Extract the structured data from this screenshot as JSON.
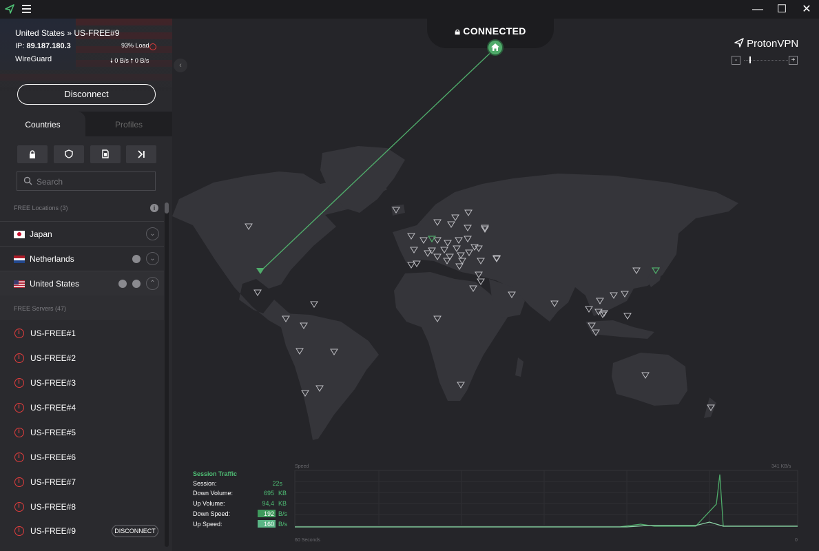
{
  "window": {
    "minimize_glyph": "—",
    "maximize_glyph": "☐",
    "close_glyph": "✕",
    "app_icon": "protonvpn-logo-icon",
    "menu_icon": "hamburger-menu-icon"
  },
  "connection": {
    "server": "United States » US-FREE#9",
    "ip_label": "IP:",
    "ip": "89.187.180.3",
    "load": "93% Load",
    "protocol": "WireGuard",
    "down_speed": "0 B/s",
    "up_speed": "0 B/s",
    "disconnect_label": "Disconnect"
  },
  "tabs": {
    "countries": "Countries",
    "profiles": "Profiles"
  },
  "filters": {
    "icons": [
      "lock-icon",
      "shield-icon",
      "file-icon",
      "arrow-skip-icon"
    ]
  },
  "search": {
    "placeholder": "Search"
  },
  "free_locations": {
    "header": "FREE Locations (3)",
    "countries": [
      {
        "name": "Japan"
      },
      {
        "name": "Netherlands"
      },
      {
        "name": "United States"
      }
    ]
  },
  "free_servers": {
    "header": "FREE Servers (47)",
    "servers": [
      {
        "name": "US-FREE#1"
      },
      {
        "name": "US-FREE#2"
      },
      {
        "name": "US-FREE#3"
      },
      {
        "name": "US-FREE#4"
      },
      {
        "name": "US-FREE#5"
      },
      {
        "name": "US-FREE#6"
      },
      {
        "name": "US-FREE#7"
      },
      {
        "name": "US-FREE#8"
      },
      {
        "name": "US-FREE#9"
      }
    ],
    "active_disconnect_label": "DISCONNECT"
  },
  "status": {
    "text": "CONNECTED",
    "color": "#4fab6a"
  },
  "brand": {
    "name": "ProtonVPN",
    "zoom_minus": "-",
    "zoom_plus": "+"
  },
  "session": {
    "title": "Session Traffic",
    "session_label": "Session:",
    "session_value": "22s",
    "down_volume_label": "Down Volume:",
    "down_volume_value": "695",
    "down_volume_unit": "KB",
    "up_volume_label": "Up Volume:",
    "up_volume_value": "94,4",
    "up_volume_unit": "KB",
    "down_speed_label": "Down Speed:",
    "down_speed_value": "192",
    "down_speed_unit": "B/s",
    "up_speed_label": "Up Speed:",
    "up_speed_value": "160",
    "up_speed_unit": "B/s"
  },
  "graph": {
    "speed_label": "Speed",
    "max_label": "341  KB/s",
    "time_label": "60 Seconds",
    "zero_label": "0"
  },
  "colors": {
    "accent_green": "#4fab6a",
    "load_red": "#e23d3d",
    "sidebar_bg": "#2a2a2e",
    "map_bg": "#252529"
  }
}
